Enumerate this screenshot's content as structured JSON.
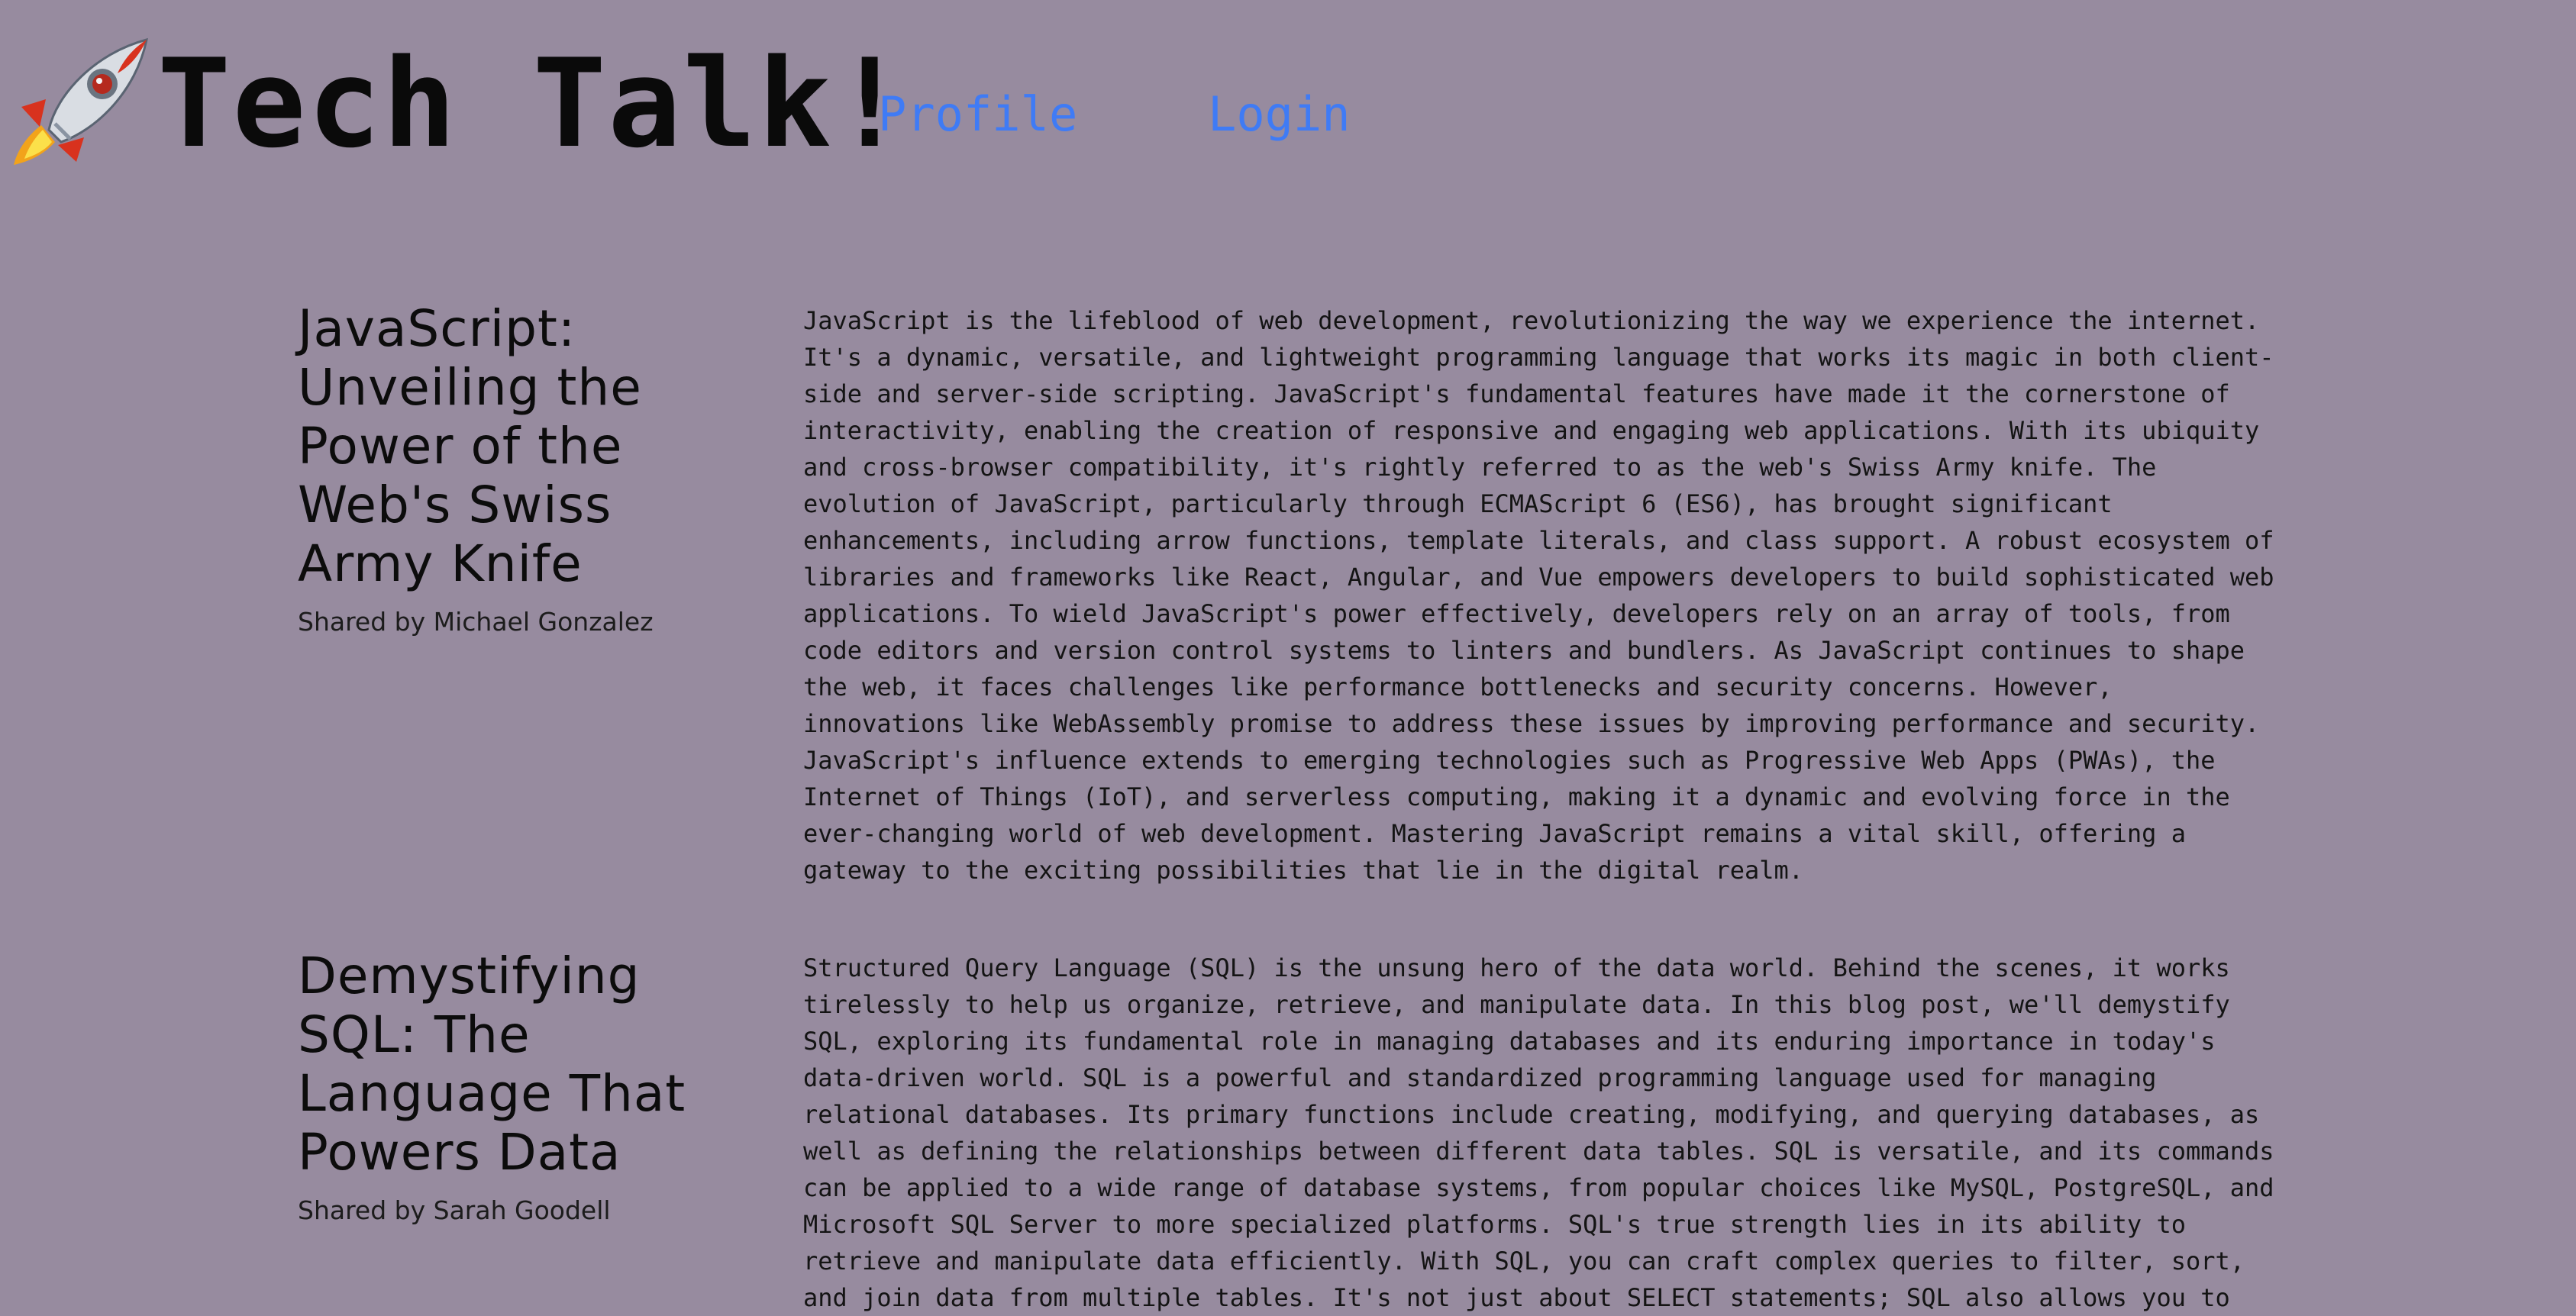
{
  "header": {
    "logo_icon": "rocket-icon",
    "site_title": "Tech Talk!",
    "nav": {
      "profile_label": "Profile",
      "login_label": "Login"
    },
    "colors": {
      "background": "#978b9f",
      "link": "#3f7bf5",
      "text": "#0a0a0a"
    }
  },
  "posts": [
    {
      "title": "JavaScript: Unveiling the Power of the Web's Swiss Army Knife",
      "author": "Shared by Michael Gonzalez",
      "body": "JavaScript is the lifeblood of web development, revolutionizing the way we experience the internet. It's a dynamic, versatile, and lightweight programming language that works its magic in both client-side and server-side scripting. JavaScript's fundamental features have made it the cornerstone of interactivity, enabling the creation of responsive and engaging web applications. With its ubiquity and cross-browser compatibility, it's rightly referred to as the web's Swiss Army knife. The evolution of JavaScript, particularly through ECMAScript 6 (ES6), has brought significant enhancements, including arrow functions, template literals, and class support. A robust ecosystem of libraries and frameworks like React, Angular, and Vue empowers developers to build sophisticated web applications. To wield JavaScript's power effectively, developers rely on an array of tools, from code editors and version control systems to linters and bundlers. As JavaScript continues to shape the web, it faces challenges like performance bottlenecks and security concerns. However, innovations like WebAssembly promise to address these issues by improving performance and security. JavaScript's influence extends to emerging technologies such as Progressive Web Apps (PWAs), the Internet of Things (IoT), and serverless computing, making it a dynamic and evolving force in the ever-changing world of web development. Mastering JavaScript remains a vital skill, offering a gateway to the exciting possibilities that lie in the digital realm."
    },
    {
      "title": "Demystifying SQL: The Language That Powers Data",
      "author": "Shared by Sarah Goodell",
      "body": "Structured Query Language (SQL) is the unsung hero of the data world. Behind the scenes, it works tirelessly to help us organize, retrieve, and manipulate data. In this blog post, we'll demystify SQL, exploring its fundamental role in managing databases and its enduring importance in today's data-driven world. SQL is a powerful and standardized programming language used for managing relational databases. Its primary functions include creating, modifying, and querying databases, as well as defining the relationships between different data tables. SQL is versatile, and its commands can be applied to a wide range of database systems, from popular choices like MySQL, PostgreSQL, and Microsoft SQL Server to more specialized platforms. SQL's true strength lies in its ability to retrieve and manipulate data efficiently. With SQL, you can craft complex queries to filter, sort, and join data from multiple tables. It's not just about SELECT statements; SQL also allows you to"
    }
  ]
}
